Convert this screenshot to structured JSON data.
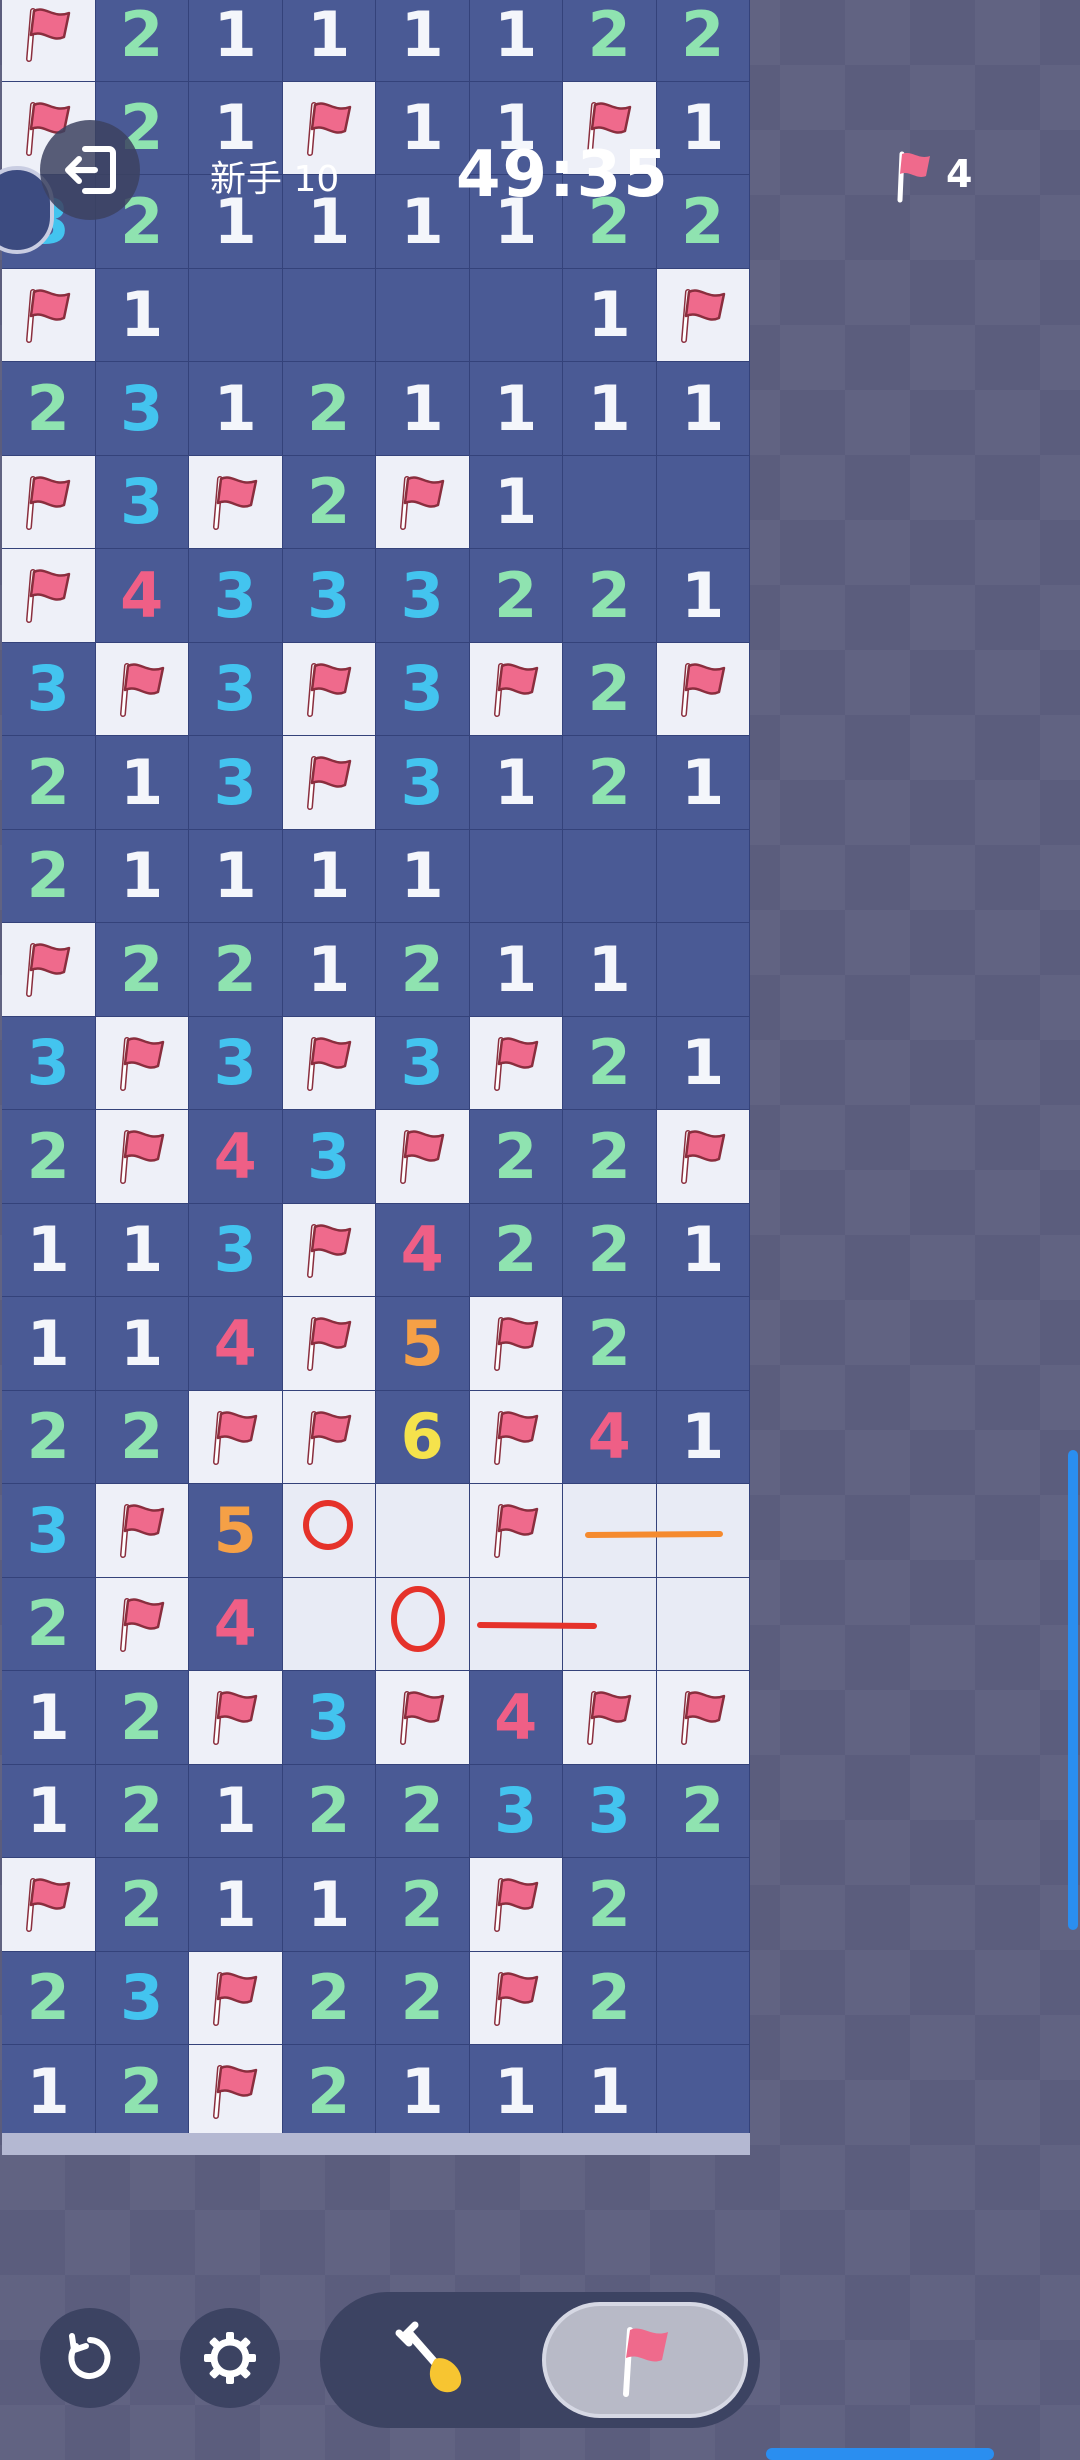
{
  "hud": {
    "level_label": "新手 10",
    "timer": "49:35",
    "flags_remaining": "4"
  },
  "icons": {
    "exit": "exit-icon",
    "restart": "restart-icon",
    "settings": "gear-icon",
    "dig": "shovel-icon",
    "flag": "flag-icon"
  },
  "board": {
    "columns": 8,
    "rows": [
      [
        "F",
        "2",
        "1",
        "1",
        "1",
        "1",
        "2",
        "2"
      ],
      [
        "F",
        "2",
        "1",
        "F",
        "1",
        "1",
        "F",
        "1"
      ],
      [
        "3",
        "2",
        "1",
        "1",
        "1",
        "1",
        "2",
        "2"
      ],
      [
        "F",
        "1",
        "",
        "",
        "",
        "",
        "1",
        "F"
      ],
      [
        "2",
        "3",
        "1",
        "2",
        "1",
        "1",
        "1",
        "1"
      ],
      [
        "F",
        "3",
        "F",
        "2",
        "F",
        "1",
        "",
        ""
      ],
      [
        "F",
        "4",
        "3",
        "3",
        "3",
        "2",
        "2",
        "1"
      ],
      [
        "3",
        "F",
        "3",
        "F",
        "3",
        "F",
        "2",
        "F"
      ],
      [
        "2",
        "1",
        "3",
        "F",
        "3",
        "1",
        "2",
        "1"
      ],
      [
        "2",
        "1",
        "1",
        "1",
        "1",
        "",
        "",
        ""
      ],
      [
        "F",
        "2",
        "2",
        "1",
        "2",
        "1",
        "1",
        ""
      ],
      [
        "3",
        "F",
        "3",
        "F",
        "3",
        "F",
        "2",
        "1"
      ],
      [
        "2",
        "F",
        "4",
        "3",
        "F",
        "2",
        "2",
        "F"
      ],
      [
        "1",
        "1",
        "3",
        "F",
        "4",
        "2",
        "2",
        "1"
      ],
      [
        "1",
        "1",
        "4",
        "F",
        "5",
        "F",
        "2",
        ""
      ],
      [
        "2",
        "2",
        "F",
        "F",
        "6",
        "F",
        "4",
        "1"
      ],
      [
        "3",
        "F",
        "5",
        "O",
        "",
        "F",
        "",
        ""
      ],
      [
        "2",
        "F",
        "4",
        "",
        "O",
        "",
        "",
        ""
      ],
      [
        "1",
        "2",
        "F",
        "3",
        "F",
        "4",
        "F",
        "F"
      ],
      [
        "1",
        "2",
        "1",
        "2",
        "2",
        "3",
        "3",
        "2"
      ],
      [
        "F",
        "2",
        "1",
        "1",
        "2",
        "F",
        "2",
        ""
      ],
      [
        "2",
        "3",
        "F",
        "2",
        "2",
        "F",
        "2",
        ""
      ],
      [
        "1",
        "2",
        "F",
        "2",
        "1",
        "1",
        "1",
        ""
      ]
    ],
    "cell_states": [
      [
        "f",
        "o",
        "o",
        "o",
        "o",
        "o",
        "o",
        "o"
      ],
      [
        "f",
        "o",
        "o",
        "f",
        "o",
        "o",
        "f",
        "o"
      ],
      [
        "o",
        "o",
        "o",
        "o",
        "o",
        "o",
        "o",
        "o"
      ],
      [
        "f",
        "o",
        "c",
        "c",
        "c",
        "c",
        "o",
        "f"
      ],
      [
        "o",
        "o",
        "o",
        "o",
        "o",
        "o",
        "o",
        "o"
      ],
      [
        "f",
        "o",
        "f",
        "o",
        "f",
        "o",
        "c",
        "c"
      ],
      [
        "f",
        "o",
        "o",
        "o",
        "o",
        "o",
        "o",
        "o"
      ],
      [
        "o",
        "f",
        "o",
        "f",
        "o",
        "f",
        "o",
        "f"
      ],
      [
        "o",
        "o",
        "o",
        "f",
        "o",
        "o",
        "o",
        "o"
      ],
      [
        "o",
        "o",
        "o",
        "o",
        "o",
        "c",
        "c",
        "c"
      ],
      [
        "f",
        "o",
        "o",
        "o",
        "o",
        "o",
        "o",
        "c"
      ],
      [
        "o",
        "f",
        "o",
        "f",
        "o",
        "f",
        "o",
        "o"
      ],
      [
        "o",
        "f",
        "o",
        "o",
        "f",
        "o",
        "o",
        "f"
      ],
      [
        "o",
        "o",
        "o",
        "f",
        "o",
        "o",
        "o",
        "o"
      ],
      [
        "o",
        "o",
        "o",
        "f",
        "o",
        "f",
        "o",
        "c"
      ],
      [
        "o",
        "o",
        "f",
        "f",
        "o",
        "f",
        "o",
        "o"
      ],
      [
        "o",
        "f",
        "o",
        "e",
        "e",
        "f",
        "e",
        "e"
      ],
      [
        "o",
        "f",
        "o",
        "e",
        "e",
        "e",
        "e",
        "e"
      ],
      [
        "o",
        "o",
        "f",
        "o",
        "f",
        "o",
        "f",
        "f"
      ],
      [
        "o",
        "o",
        "o",
        "o",
        "o",
        "o",
        "o",
        "o"
      ],
      [
        "f",
        "o",
        "o",
        "o",
        "o",
        "f",
        "o",
        "c"
      ],
      [
        "o",
        "o",
        "f",
        "o",
        "o",
        "f",
        "o",
        "c"
      ],
      [
        "o",
        "o",
        "f",
        "o",
        "o",
        "o",
        "o",
        "c"
      ]
    ]
  },
  "colors": {
    "accent": "#2a8ef0",
    "flag": "#ef6a8c",
    "mark_red": "#e5322a",
    "mark_orange": "#f58a2e"
  }
}
